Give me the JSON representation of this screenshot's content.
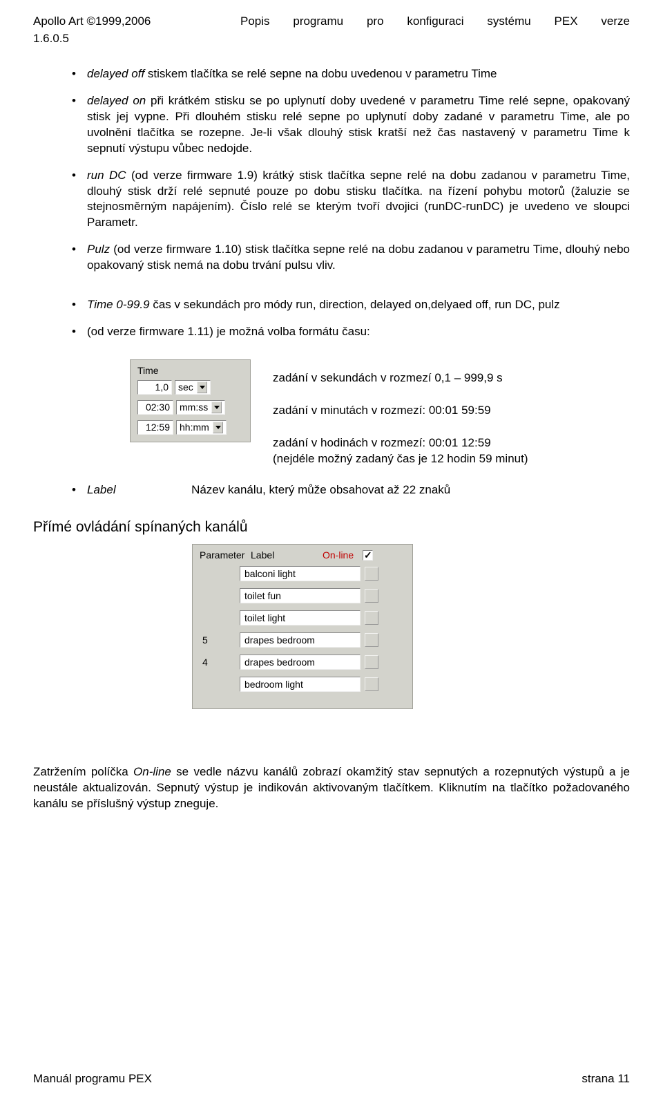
{
  "header": {
    "left": "Apollo Art   ©1999,2006",
    "center": "Popis  programu  pro  konfiguraci  systému  PEX  verze",
    "sub": "1.6.0.5"
  },
  "bullets1": [
    {
      "lead": "delayed off",
      "text": "stiskem tlačítka se relé sepne na dobu uvedenou v parametru Time"
    },
    {
      "lead": "delayed on",
      "text": "při krátkém stisku se po uplynutí doby uvedené v parametru Time relé sepne, opakovaný stisk jej vypne. Při dlouhém stisku relé sepne po uplynutí doby zadané v parametru Time, ale po uvolnění tlačítka se rozepne. Je-li však dlouhý stisk kratší než čas nastavený v parametru Time k sepnutí výstupu vůbec nedojde."
    },
    {
      "lead": "run DC",
      "text": "(od verze firmware 1.9) krátký stisk tlačítka sepne relé na dobu zadanou v parametru Time, dlouhý stisk drží relé sepnuté pouze po dobu stisku tlačítka. na řízení pohybu motorů (žaluzie se stejnosměrným napájením). Číslo relé se kterým tvoří dvojici (runDC-runDC) je uvedeno ve sloupci Parametr."
    },
    {
      "lead": "Pulz",
      "text": "(od verze firmware 1.10) stisk tlačítka sepne relé na dobu zadanou v parametru Time, dlouhý nebo opakovaný stisk nemá na dobu trvání pulsu vliv."
    }
  ],
  "bullets2": [
    {
      "lead": "Time",
      "range": "0-99.9",
      "text": "čas v sekundách pro módy run, direction, delayed on,delyaed off, run DC, pulz"
    },
    {
      "text": "(od verze firmware 1.11) je možná volba formátu času:"
    }
  ],
  "time_panel": {
    "title": "Time",
    "rows": [
      {
        "val": "1,0",
        "unit": "sec"
      },
      {
        "val": "02:30",
        "unit": "mm:ss"
      },
      {
        "val": "12:59",
        "unit": "hh:mm"
      }
    ]
  },
  "time_descs": [
    "zadání v sekundách v rozmezí 0,1 – 999,9 s",
    "zadání v minutách v rozmezí: 00:01    59:59",
    "zadání v hodinách v rozmezí: 00:01    12:59\n(nejdéle možný zadaný čas je 12 hodin 59 minut)"
  ],
  "label_item": {
    "lead": "Label",
    "text": "Název kanálu, který může obsahovat až 22 znaků"
  },
  "section_heading": "Přímé ovládání spínaných kanálů",
  "channels_panel": {
    "h_param": "Parameter",
    "h_label": "Label",
    "h_online": "On-line",
    "online_checked": true,
    "rows": [
      {
        "param": "",
        "label": "balconi light"
      },
      {
        "param": "",
        "label": "toilet fun"
      },
      {
        "param": "",
        "label": "toilet light"
      },
      {
        "param": "5",
        "label": "drapes bedroom"
      },
      {
        "param": "4",
        "label": "drapes bedroom"
      },
      {
        "param": "",
        "label": "bedroom light"
      }
    ]
  },
  "bottom_para": "Zatržením políčka On-line se vedle názvu kanálů zobrazí okamžitý stav sepnutých a rozepnutých výstupů a je neustále aktualizován. Sepnutý výstup je indikován aktivovaným tlačítkem. Kliknutím na tlačítko požadovaného kanálu se příslušný výstup zneguje.",
  "footer": {
    "left": "Manuál programu PEX",
    "right": "strana 11"
  }
}
